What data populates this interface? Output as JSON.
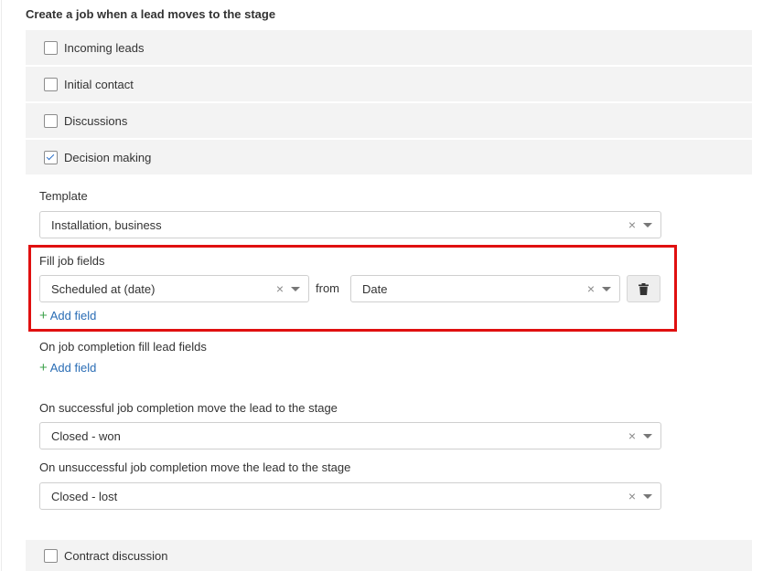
{
  "heading": "Create a job when a lead moves to the stage",
  "stages": [
    {
      "label": "Incoming leads",
      "checked": false
    },
    {
      "label": "Initial contact",
      "checked": false
    },
    {
      "label": "Discussions",
      "checked": false
    },
    {
      "label": "Decision making",
      "checked": true
    },
    {
      "label": "Contract discussion",
      "checked": false
    }
  ],
  "template": {
    "label": "Template",
    "value": "Installation, business"
  },
  "fill_job_fields": {
    "label": "Fill job fields",
    "field_value": "Scheduled at (date)",
    "from_label": "from",
    "source_value": "Date",
    "add_field": "Add field"
  },
  "completion_fill": {
    "label": "On job completion fill lead fields",
    "add_field": "Add field"
  },
  "success_stage": {
    "label": "On successful job completion move the lead to the stage",
    "value": "Closed - won"
  },
  "failure_stage": {
    "label": "On unsuccessful job completion move the lead to the stage",
    "value": "Closed - lost"
  },
  "icons": {
    "clear": "×",
    "plus": "+"
  },
  "colors": {
    "highlight": "#e01010",
    "link": "#2a6db5",
    "plus": "#3fa34d",
    "row_bg": "#f3f3f3"
  }
}
